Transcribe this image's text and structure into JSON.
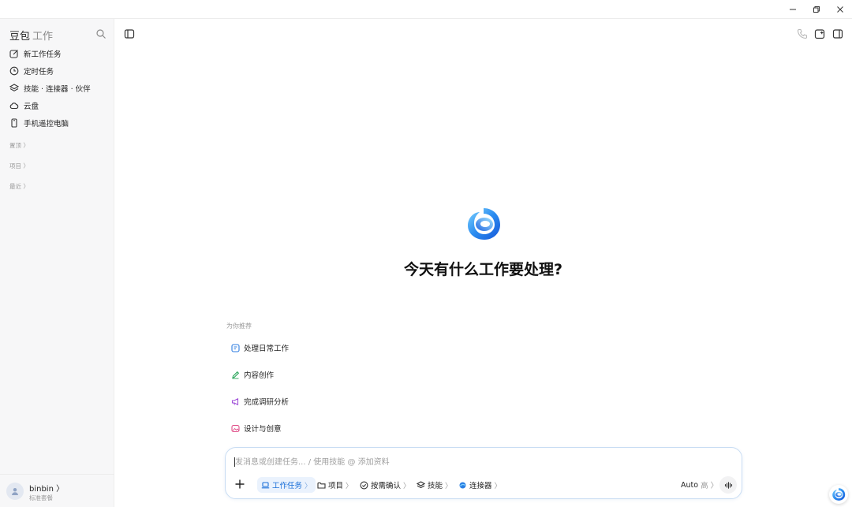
{
  "window": {
    "minimize": "—",
    "restore": "❐",
    "close": "✕"
  },
  "sidebar": {
    "brand": "豆包",
    "brand_sub": "工作",
    "items": [
      {
        "label": "新工作任务",
        "icon": "edit-icon"
      },
      {
        "label": "定时任务",
        "icon": "clock-icon"
      },
      {
        "label": "技能 · 连接器 · 伙伴",
        "icon": "layers-icon"
      },
      {
        "label": "云盘",
        "icon": "cloud-icon"
      },
      {
        "label": "手机遥控电脑",
        "icon": "phone-icon"
      }
    ],
    "sections": [
      "置顶 〉",
      "项目 〉",
      "最近 〉"
    ],
    "user": {
      "name": "binbin 〉",
      "plan": "标准套餐"
    }
  },
  "main": {
    "headline": "今天有什么工作要处理?",
    "recommend_label": "为你推荐",
    "recommendations": [
      {
        "label": "处理日常工作",
        "icon": "task-icon",
        "color": "#2f7de1"
      },
      {
        "label": "内容创作",
        "icon": "pen-icon",
        "color": "#2aa55a"
      },
      {
        "label": "完成调研分析",
        "icon": "megaphone-icon",
        "color": "#a050d8"
      },
      {
        "label": "设计与创意",
        "icon": "image-icon",
        "color": "#e0508a"
      }
    ]
  },
  "composer": {
    "placeholder": "发消息或创建任务... / 使用技能 @ 添加资料",
    "chips": [
      {
        "label": "工作任务",
        "icon": "laptop-icon",
        "active": true
      },
      {
        "label": "项目",
        "icon": "folder-icon",
        "active": false
      },
      {
        "label": "按需确认",
        "icon": "check-circle-icon",
        "active": false
      },
      {
        "label": "技能",
        "icon": "layers-icon",
        "active": false
      },
      {
        "label": "连接器",
        "icon": "connector-icon",
        "active": false
      }
    ],
    "chevron": "〉",
    "auto_label": "Auto",
    "auto_level": "高 〉"
  },
  "colors": {
    "accent": "#1a6fd8",
    "sidebar_bg": "#f7f7f8",
    "border": "#c9ddf3"
  }
}
